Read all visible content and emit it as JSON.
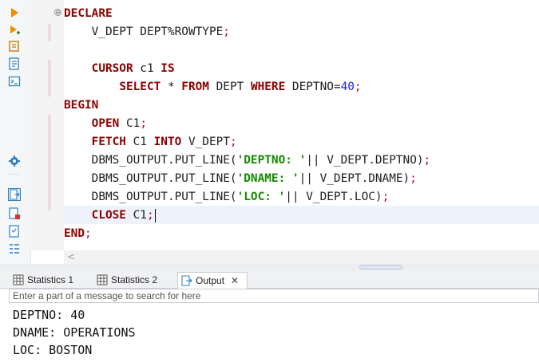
{
  "toolbar": {
    "icons": [
      "run-statement-icon",
      "run-script-icon",
      "explain-plan-icon",
      "load-script-icon",
      "format-icon",
      "console-icon",
      "settings-icon",
      "output-panel-icon",
      "export-icon",
      "results-icon",
      "outline-icon"
    ]
  },
  "editor": {
    "lines": [
      [
        {
          "t": "DECLARE",
          "c": "kw"
        }
      ],
      [
        {
          "t": "    V_DEPT DEPT%ROWTYPE",
          "c": ""
        },
        {
          "t": ";",
          "c": "pun"
        }
      ],
      [],
      [
        {
          "t": "    ",
          "c": ""
        },
        {
          "t": "CURSOR",
          "c": "kw"
        },
        {
          "t": " c1 ",
          "c": ""
        },
        {
          "t": "IS",
          "c": "kw"
        }
      ],
      [
        {
          "t": "        ",
          "c": ""
        },
        {
          "t": "SELECT",
          "c": "kw"
        },
        {
          "t": " * ",
          "c": ""
        },
        {
          "t": "FROM",
          "c": "kw"
        },
        {
          "t": " DEPT ",
          "c": ""
        },
        {
          "t": "WHERE",
          "c": "kw"
        },
        {
          "t": " DEPTNO=",
          "c": ""
        },
        {
          "t": "40",
          "c": "num"
        },
        {
          "t": ";",
          "c": "pun"
        }
      ],
      [
        {
          "t": "BEGIN",
          "c": "kw"
        }
      ],
      [
        {
          "t": "    ",
          "c": ""
        },
        {
          "t": "OPEN",
          "c": "kw"
        },
        {
          "t": " C1",
          "c": ""
        },
        {
          "t": ";",
          "c": "pun"
        }
      ],
      [
        {
          "t": "    ",
          "c": ""
        },
        {
          "t": "FETCH",
          "c": "kw"
        },
        {
          "t": " C1 ",
          "c": ""
        },
        {
          "t": "INTO",
          "c": "kw"
        },
        {
          "t": " V_DEPT",
          "c": ""
        },
        {
          "t": ";",
          "c": "pun"
        }
      ],
      [
        {
          "t": "    DBMS_OUTPUT.PUT_LINE(",
          "c": ""
        },
        {
          "t": "'DEPTNO: '",
          "c": "str"
        },
        {
          "t": "|| V_DEPT.DEPTNO)",
          "c": ""
        },
        {
          "t": ";",
          "c": "pun"
        }
      ],
      [
        {
          "t": "    DBMS_OUTPUT.PUT_LINE(",
          "c": ""
        },
        {
          "t": "'DNAME: '",
          "c": "str"
        },
        {
          "t": "|| V_DEPT.DNAME)",
          "c": ""
        },
        {
          "t": ";",
          "c": "pun"
        }
      ],
      [
        {
          "t": "    DBMS_OUTPUT.PUT_LINE(",
          "c": ""
        },
        {
          "t": "'LOC: '",
          "c": "str"
        },
        {
          "t": "|| V_DEPT.LOC)",
          "c": ""
        },
        {
          "t": ";",
          "c": "pun"
        }
      ],
      [
        {
          "t": "    ",
          "c": ""
        },
        {
          "t": "CLOSE",
          "c": "kw"
        },
        {
          "t": " C1",
          "c": ""
        },
        {
          "t": ";",
          "c": "pun"
        }
      ],
      [
        {
          "t": "END",
          "c": "kw"
        },
        {
          "t": ";",
          "c": "pun"
        }
      ]
    ],
    "current_line": 11,
    "fold_glyph": "⊖"
  },
  "scroll": {
    "left_arrow": "<"
  },
  "tabs": [
    {
      "label": "Statistics 1",
      "icon": "grid-icon",
      "active": false
    },
    {
      "label": "Statistics 2",
      "icon": "grid-icon",
      "active": false
    },
    {
      "label": "Output",
      "icon": "output-icon",
      "active": true,
      "close": "✕"
    }
  ],
  "search": {
    "placeholder": "Enter a part of a message to search for here",
    "value": ""
  },
  "output": {
    "lines": [
      "DEPTNO: 40",
      "DNAME: OPERATIONS",
      "LOC: BOSTON"
    ]
  },
  "colors": {
    "keyword": "#8b0000",
    "string": "#138a00",
    "number": "#1a1aff",
    "punctuation": "#b3003c",
    "current_line": "#eef3fb"
  }
}
